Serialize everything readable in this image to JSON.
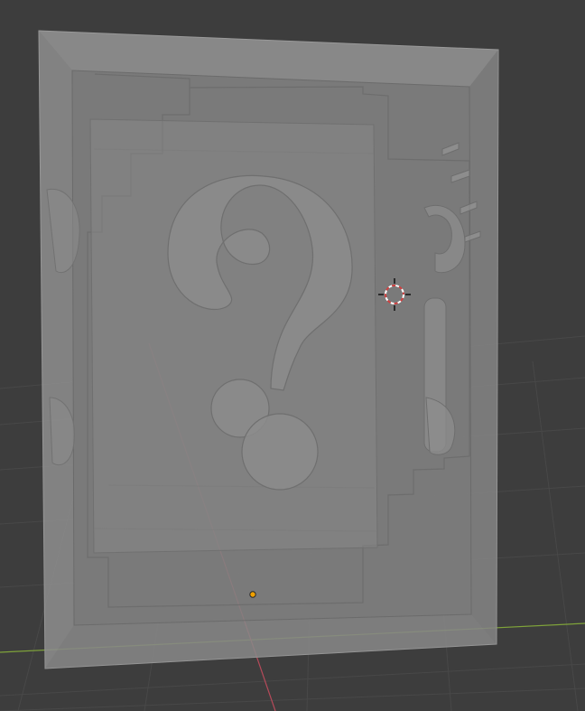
{
  "viewport": {
    "background": "#3d3d3d",
    "grid_color": "#474747",
    "x_axis_color": "#7fa33a",
    "y_axis_color": "#b64a5a"
  },
  "scene_object": {
    "type": "question-block-box",
    "shading": "x-ray",
    "color": "#8a8a8a"
  },
  "gizmos": {
    "cursor_icon": "3d-cursor-icon",
    "origin_icon": "object-origin-icon",
    "origin_color": "#f0a000"
  }
}
